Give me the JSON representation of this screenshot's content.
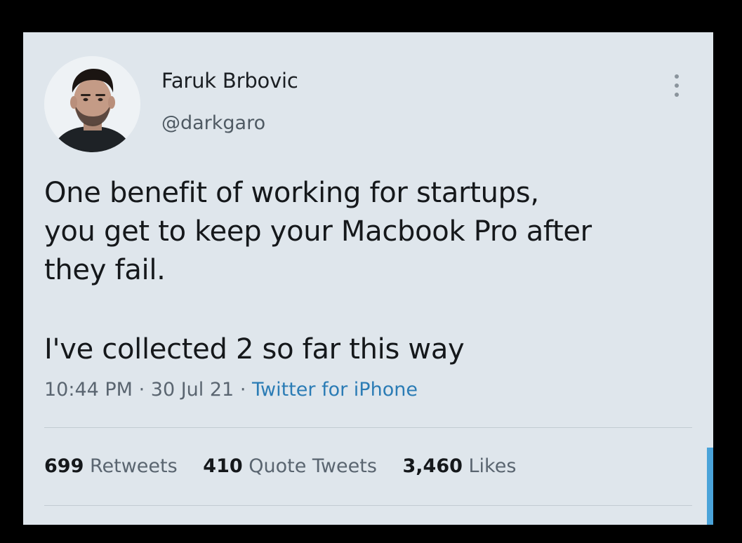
{
  "user": {
    "display_name": "Faruk Brbovic",
    "handle": "@darkgaro"
  },
  "tweet": {
    "lines": [
      "One benefit of working for startups,",
      "you get to keep your Macbook Pro after",
      "they fail."
    ],
    "line2": "I've collected 2 so far this way",
    "time": "10:44 PM",
    "date": "30 Jul 21",
    "source": "Twitter for iPhone",
    "separator": "·"
  },
  "stats": {
    "retweets_count": "699",
    "retweets_label": "Retweets",
    "quotes_count": "410",
    "quotes_label": "Quote Tweets",
    "likes_count": "3,460",
    "likes_label": "Likes"
  },
  "icons": {
    "more": "more-vertical-icon"
  },
  "colors": {
    "card_bg": "#dfe6ec",
    "frame_bg": "#000000",
    "text": "#15181b",
    "muted": "#5a6570",
    "link": "#2b7cb5",
    "accent": "#4aa3d9"
  }
}
